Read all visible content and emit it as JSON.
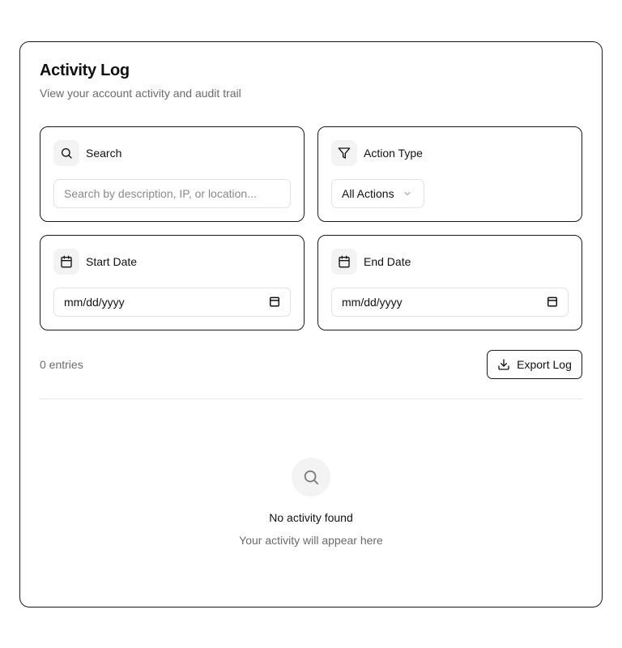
{
  "header": {
    "title": "Activity Log",
    "subtitle": "View your account activity and audit trail"
  },
  "filters": {
    "search": {
      "label": "Search",
      "icon": "search-icon",
      "placeholder": "Search by description, IP, or location...",
      "value": ""
    },
    "action_type": {
      "label": "Action Type",
      "icon": "filter-icon",
      "selected": "All Actions"
    },
    "start_date": {
      "label": "Start Date",
      "icon": "calendar-icon",
      "value": "mm/dd/yyyy"
    },
    "end_date": {
      "label": "End Date",
      "icon": "calendar-icon",
      "value": "mm/dd/yyyy"
    }
  },
  "toolbar": {
    "entries_text": "0 entries",
    "export_label": "Export Log"
  },
  "empty_state": {
    "title": "No activity found",
    "subtitle": "Your activity will appear here"
  },
  "colors": {
    "border": "#1a1a1a",
    "muted_text": "#6b6b6b",
    "icon_tile": "#f3f3f3"
  }
}
